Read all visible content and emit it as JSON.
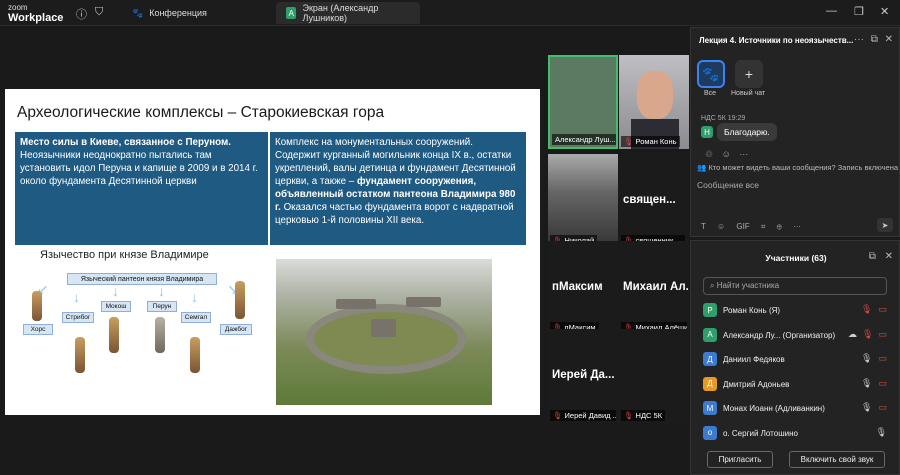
{
  "app": {
    "logo_line1": "zoom",
    "logo_line2": "Workplace"
  },
  "titlebar": {
    "conference_tab": "Конференция",
    "screen_tab": "Экран (Александр Лушников)",
    "screen_tab_badge": "A"
  },
  "slide": {
    "title": "Археологические комплексы – Старокиевская гора",
    "left_heading": "Место силы в Киеве, связанное с Перуном.",
    "left_body": "Неоязычники неоднократно пытались там установить идол Перуна и капище в 2009 и в 2014 г. около фундамента Десятинной церкви",
    "right_body_1": "Комплекс на монументальных сооружений. Содержит курганный могильник конца IX в., остатки укреплений, валы детинца и фундамент Десятинной церкви, а также – ",
    "right_bold": "фундамент сооружения, объявленный остатком пантеона Владимира 980 г.",
    "right_body_2": "Оказался частью фундамента ворот с надвратной церковью 1-й половины XII века.",
    "diagram_title": "Язычество при князе Владимире",
    "diagram_center": "Языческий пантеон князя Владимира",
    "gods": [
      "Хорс",
      "Стрибог",
      "Мокош",
      "Перун",
      "Семгал",
      "Дажбог"
    ]
  },
  "tiles": [
    {
      "name": "Александр Луш..."
    },
    {
      "name": "Роман Конь"
    },
    {
      "name": "Николай"
    },
    {
      "name": "священник ...",
      "big": "священ..."
    },
    {
      "name": "пМаксим",
      "big": "пМаксим"
    },
    {
      "name": "Михаил Алёшин",
      "big": "Михаил Ал..."
    },
    {
      "name": "Иерей Давид ...",
      "big": "Иерей Да..."
    },
    {
      "name": "НДС 5К"
    }
  ],
  "chat": {
    "title": "Лекция 4. Источники по неоязычеств...",
    "channel_all": "Все",
    "channel_new": "Новый чат",
    "msg_meta": "НДС 5К 19:29",
    "msg_avatar": "Н",
    "msg_text": "Благодарю.",
    "who_can_see": "Кто может видеть ваши сообщения? Запись включена",
    "input_placeholder": "Сообщение все",
    "format_icons": "T ☺ GIF ⌗ ⊕ ···"
  },
  "participants": {
    "title": "Участники (63)",
    "search_placeholder": "Найти участника",
    "list": [
      {
        "avatar": "Р",
        "name": "Роман Конь (Я)",
        "color": "#2e9e6b"
      },
      {
        "avatar": "А",
        "name": "Александр Лу... (Организатор)",
        "color": "#2e9e6b"
      },
      {
        "avatar": "Д",
        "name": "Даниил Федяков",
        "color": "#3b7bd1"
      },
      {
        "avatar": "Д",
        "name": "Дмитрий Адоньев",
        "color": "#e69a24"
      },
      {
        "avatar": "М",
        "name": "Монах Иоанн (Адливанкин)",
        "color": "#3b7bd1"
      },
      {
        "avatar": "о",
        "name": "о. Сергий Лотошино",
        "color": "#3b7bd1"
      }
    ],
    "invite": "Пригласить",
    "unmute": "Включить свой звук"
  }
}
